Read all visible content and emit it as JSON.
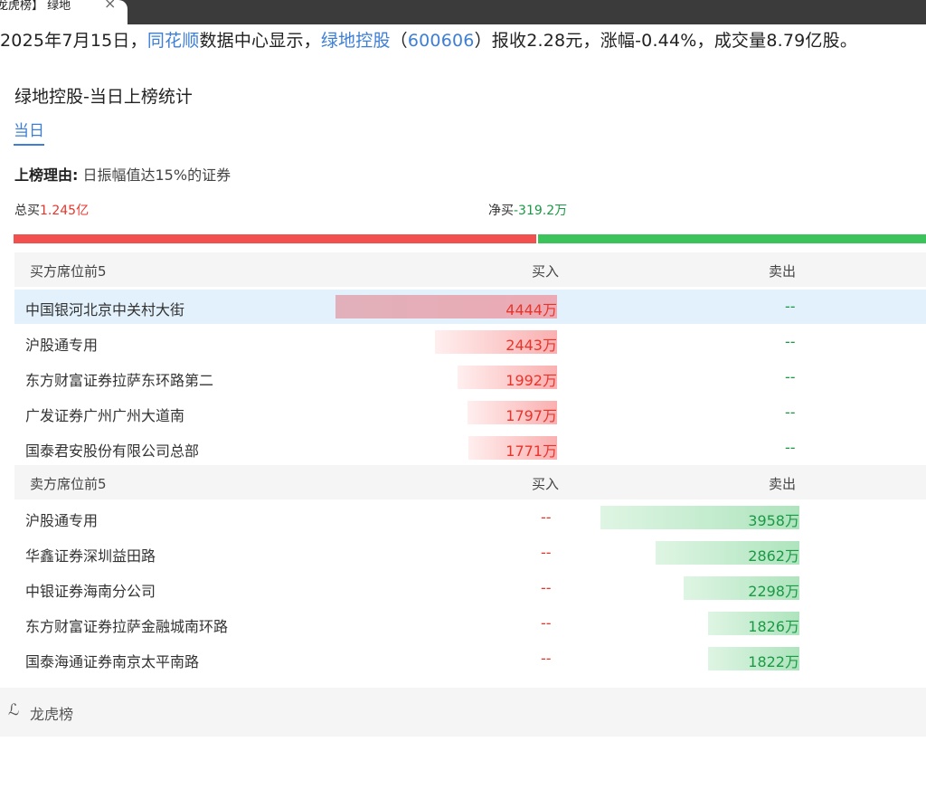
{
  "tab": {
    "title": "龙虎榜】 绿地",
    "close": "×"
  },
  "headline": {
    "prefix": "2025年7月15日，",
    "source_link": "同花顺",
    "mid": "数据中心显示，",
    "stock_link": "绿地控股",
    "open_paren": "（",
    "code_link": "600606",
    "suffix": "）报收2.28元，涨幅-0.44%，成交量8.79亿股。"
  },
  "card": {
    "title": "绿地控股-当日上榜统计",
    "day_tab": "当日",
    "reason_label": "上榜理由:",
    "reason_text": "日振幅值达15%的证券",
    "total_buy_label": "总买",
    "total_buy_value": "1.245亿",
    "net_buy_label": "净买",
    "net_buy_value": "-319.2万",
    "buy_ratio": 0.5725
  },
  "buy_section": {
    "header": {
      "name": "买方席位前5",
      "buy": "买入",
      "sell": "卖出"
    },
    "rows": [
      {
        "name": "中国银河北京中关村大街",
        "buy": "4444万",
        "buy_num": 4444,
        "sell": "--"
      },
      {
        "name": "沪股通专用",
        "buy": "2443万",
        "buy_num": 2443,
        "sell": "--"
      },
      {
        "name": "东方财富证券拉萨东环路第二",
        "buy": "1992万",
        "buy_num": 1992,
        "sell": "--"
      },
      {
        "name": "广发证券广州广州大道南",
        "buy": "1797万",
        "buy_num": 1797,
        "sell": "--"
      },
      {
        "name": "国泰君安股份有限公司总部",
        "buy": "1771万",
        "buy_num": 1771,
        "sell": "--"
      }
    ]
  },
  "sell_section": {
    "header": {
      "name": "卖方席位前5",
      "buy": "买入",
      "sell": "卖出"
    },
    "rows": [
      {
        "name": "沪股通专用",
        "buy": "--",
        "sell": "3958万",
        "sell_num": 3958
      },
      {
        "name": "华鑫证券深圳益田路",
        "buy": "--",
        "sell": "2862万",
        "sell_num": 2862
      },
      {
        "name": "中银证券海南分公司",
        "buy": "--",
        "sell": "2298万",
        "sell_num": 2298
      },
      {
        "name": "东方财富证券拉萨金融城南环路",
        "buy": "--",
        "sell": "1826万",
        "sell_num": 1826
      },
      {
        "name": "国泰海通证券南京太平南路",
        "buy": "--",
        "sell": "1822万",
        "sell_num": 1822
      }
    ]
  },
  "footer": {
    "icon": "link-icon",
    "label": "龙虎榜"
  }
}
